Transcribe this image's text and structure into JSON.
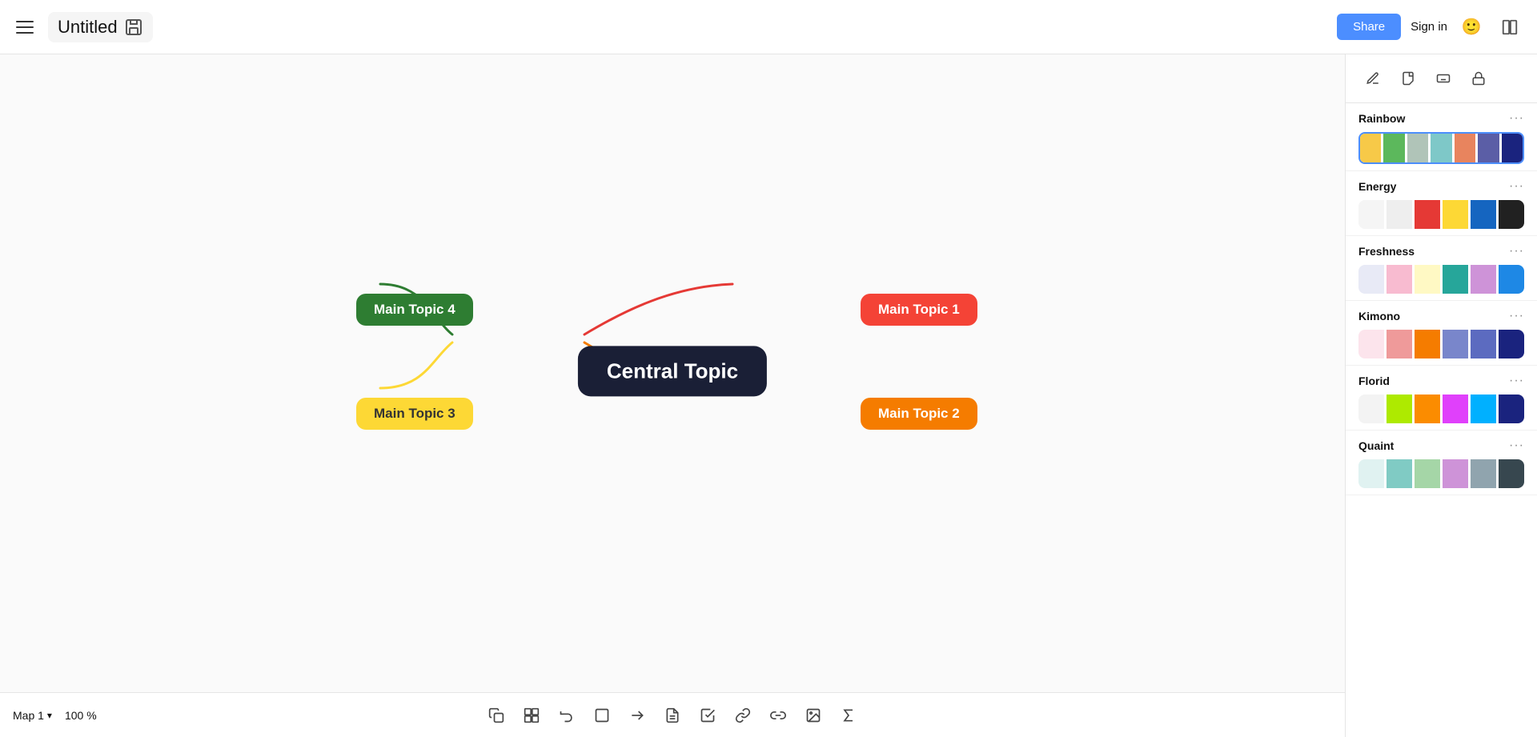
{
  "header": {
    "menu_label": "Menu",
    "title": "Untitled",
    "share_label": "Share",
    "signin_label": "Sign in"
  },
  "mindmap": {
    "central_topic": "Central Topic",
    "nodes": [
      {
        "id": "mt1",
        "label": "Main Topic 1",
        "color": "#f44336",
        "text_color": "#fff"
      },
      {
        "id": "mt2",
        "label": "Main Topic 2",
        "color": "#f57c00",
        "text_color": "#fff"
      },
      {
        "id": "mt3",
        "label": "Main Topic 3",
        "color": "#fdd835",
        "text_color": "#333"
      },
      {
        "id": "mt4",
        "label": "Main Topic 4",
        "color": "#2e7d32",
        "text_color": "#fff"
      }
    ]
  },
  "canvas_footer": {
    "map_name": "Map 1",
    "zoom": "100 %"
  },
  "canvas_toolbar": {
    "tools": [
      {
        "name": "copy",
        "icon": "⧉"
      },
      {
        "name": "paste-style",
        "icon": "⊞"
      },
      {
        "name": "undo",
        "icon": "↺"
      },
      {
        "name": "frame",
        "icon": "⬜"
      },
      {
        "name": "topic",
        "icon": "⊣"
      },
      {
        "name": "note",
        "icon": "📝"
      },
      {
        "name": "task",
        "icon": "☑"
      },
      {
        "name": "link",
        "icon": "🔗"
      },
      {
        "name": "link2",
        "icon": "⛓"
      },
      {
        "name": "image",
        "icon": "🖼"
      },
      {
        "name": "formula",
        "icon": "∑"
      }
    ]
  },
  "right_panel": {
    "tools": [
      {
        "name": "pen",
        "icon": "✏"
      },
      {
        "name": "sticky",
        "icon": "🗒"
      },
      {
        "name": "shortcut",
        "icon": "⌨"
      },
      {
        "name": "lock",
        "icon": "🔒"
      }
    ],
    "palettes": [
      {
        "name": "Rainbow",
        "selected": true,
        "colors": [
          "#f7c948",
          "#5cb85c",
          "#b0c4b8",
          "#7ec8c8",
          "#e8845e",
          "#5b5ea6",
          "#1a237e"
        ]
      },
      {
        "name": "Energy",
        "selected": false,
        "colors": [
          "#f5f5f5",
          "#eeeeee",
          "#e53935",
          "#fdd835",
          "#1565c0",
          "#212121"
        ]
      },
      {
        "name": "Freshness",
        "selected": false,
        "colors": [
          "#e8eaf6",
          "#f8bbd0",
          "#fff9c4",
          "#26a69a",
          "#ce93d8",
          "#1e88e5"
        ]
      },
      {
        "name": "Kimono",
        "selected": false,
        "colors": [
          "#fce4ec",
          "#ef9a9a",
          "#f57c00",
          "#7986cb",
          "#5c6bc0",
          "#1a237e"
        ]
      },
      {
        "name": "Florid",
        "selected": false,
        "colors": [
          "#f3f3f3",
          "#aeea00",
          "#fb8c00",
          "#e040fb",
          "#00b0ff",
          "#1a237e"
        ]
      },
      {
        "name": "Quaint",
        "selected": false,
        "colors": [
          "#e0f2f1",
          "#80cbc4",
          "#a5d6a7",
          "#ce93d8",
          "#90a4ae",
          "#37474f"
        ]
      }
    ]
  }
}
